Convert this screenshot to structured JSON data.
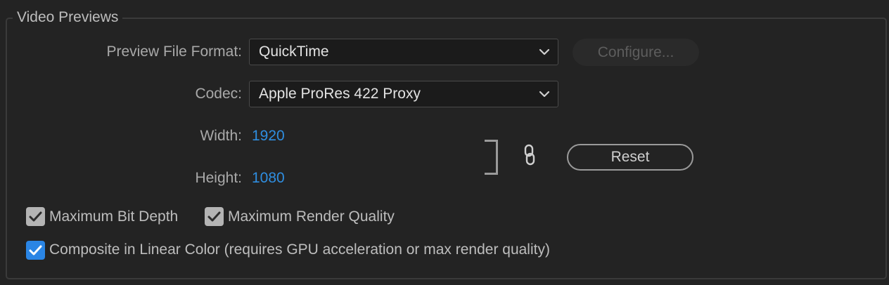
{
  "group": {
    "title": "Video Previews"
  },
  "preview_file_format": {
    "label": "Preview File Format:",
    "value": "QuickTime",
    "configure_label": "Configure..."
  },
  "codec": {
    "label": "Codec:",
    "value": "Apple ProRes 422 Proxy"
  },
  "dimensions": {
    "width_label": "Width:",
    "width_value": "1920",
    "height_label": "Height:",
    "height_value": "1080",
    "reset_label": "Reset",
    "link_icon": "chain-link-icon"
  },
  "options": {
    "max_bit_depth": {
      "label": "Maximum Bit Depth",
      "checked": true
    },
    "max_render_quality": {
      "label": "Maximum Render Quality",
      "checked": true
    },
    "composite_linear": {
      "label": "Composite in Linear Color (requires GPU acceleration or max render quality)",
      "checked": true
    }
  },
  "colors": {
    "background": "#232323",
    "accent": "#2a85e5",
    "value_text": "#2f8ee0",
    "checkbox_gray": "#b4b4b4"
  }
}
